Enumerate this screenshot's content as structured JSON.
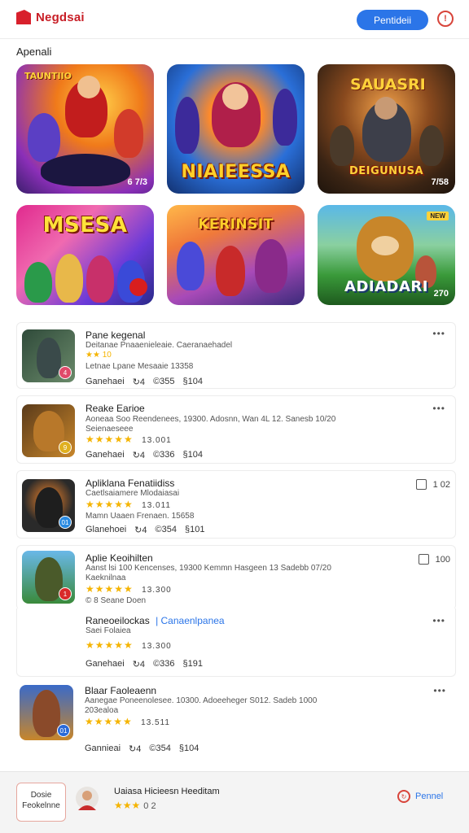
{
  "header": {
    "logo_text": "Negdsai",
    "button_label": "Pentideii",
    "icon": "alert-search-icon"
  },
  "section": {
    "title": "Apenali"
  },
  "featured": [
    {
      "caption": "",
      "top_text": "TAUNTIIO",
      "badge": "6 7/3"
    },
    {
      "caption": "NIAIEESSA",
      "top_text": "",
      "badge": ""
    },
    {
      "caption": "DEIGUNUSA",
      "top_text": "SAUASRI",
      "badge": "7/58"
    },
    {
      "caption": "MSESA",
      "top_text": "",
      "badge": ""
    },
    {
      "caption": "KERINSIT",
      "top_text": "",
      "badge": ""
    },
    {
      "caption": "ADIADARI",
      "top_text": "",
      "badge": "270"
    }
  ],
  "items": [
    {
      "title": "Pane kegenal",
      "sub1": "Deitanae Pnaaenieleaie. Caeranaehadel",
      "sub2": "★★ 10",
      "sub3": "Letnae Lpane Mesaaie 13358",
      "meta": [
        "Ganehaei",
        "↻4",
        "©355",
        "§104"
      ],
      "menu": "•••",
      "rating_badge": "4"
    },
    {
      "title": "Reake Earioe",
      "sub1": "Aoneaa Soo Reendenees, 19300. Adosnn, Wan 4L 12. Sanesb 10/20",
      "sub2": "Seienaeseee",
      "stars": "★★★★★",
      "rating": "13.001",
      "meta": [
        "Ganehaei",
        "↻4",
        "©336",
        "§104"
      ],
      "menu": "•••",
      "rating_badge": "9"
    },
    {
      "title": "Apliklana Fenatiidiss",
      "sub1": "Caetlsaiamere Mlodaiasai",
      "stars": "★★★★★",
      "rating": "13.011",
      "sub3": "Mamn Uaaen Frenaen. 15658",
      "meta": [
        "Glanehoei",
        "↻4",
        "©354",
        "§101"
      ],
      "right_value": "1 02",
      "rating_badge": "01"
    },
    {
      "title": "Aplie Keoihilten",
      "sub1": "Aanst lsi 100 Kencenses, 19300 Kemmn Hasgeen 13 Sadebb 07/20",
      "sub2": "Kaeknilnaa",
      "stars": "★★★★★",
      "rating": "13.300",
      "sub3": "© 8 Seane Doen",
      "right_value": "100",
      "rating_badge": "1"
    },
    {
      "title": "Raneoeilockas",
      "title_link": "Canaenlpanea",
      "sub2": "Saei Folaiea",
      "stars": "★★★★★",
      "rating": "13.300",
      "meta": [
        "Ganehaei",
        "↻4",
        "©336",
        "§191"
      ],
      "menu": "•••"
    },
    {
      "title": "Blaar Faoleaenn",
      "sub1": "Aanegae Poneenolesee. 10300. Adoeeheger S012. Sadeb 1000",
      "sub2": "203ealoa",
      "stars": "★★★★★",
      "rating": "13.511",
      "meta": [
        "Gannieai",
        "↻4",
        "©354",
        "§104"
      ],
      "menu": "•••",
      "rating_badge": "01"
    }
  ],
  "bottom": {
    "button_line1": "Dosie",
    "button_line2": "Feokelnne",
    "title": "Uaiasa Hicieesn Heeditam",
    "stars": "★★★",
    "rating": "0 2",
    "action_label": "Pennel"
  }
}
